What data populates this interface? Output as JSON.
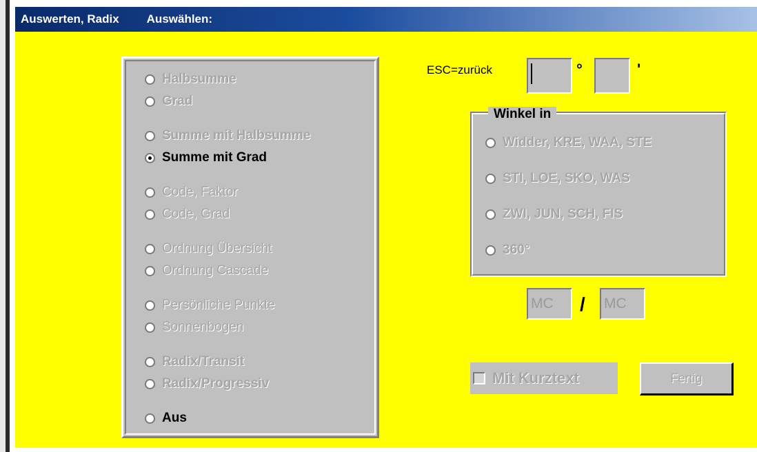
{
  "window": {
    "title": "Auswerten, Radix",
    "subtitle": "Auswählen:"
  },
  "left_options": [
    {
      "label": "Halbsumme",
      "enabled": false,
      "checked": false,
      "bold": true
    },
    {
      "label": "Grad",
      "enabled": false,
      "checked": false,
      "bold": true
    },
    {
      "label": "Summe mit Halbsumme",
      "enabled": false,
      "checked": false,
      "bold": true
    },
    {
      "label": "Summe mit Grad",
      "enabled": true,
      "checked": true,
      "bold": true
    },
    {
      "label": "Code, Faktor",
      "enabled": false,
      "checked": false,
      "bold": false
    },
    {
      "label": "Code, Grad",
      "enabled": false,
      "checked": false,
      "bold": false
    },
    {
      "label": "Ordnung Übersicht",
      "enabled": false,
      "checked": false,
      "bold": false
    },
    {
      "label": "Ordnung Cascade",
      "enabled": false,
      "checked": false,
      "bold": false
    },
    {
      "label": "Persönliche Punkte",
      "enabled": false,
      "checked": false,
      "bold": false
    },
    {
      "label": "Sonnenbogen",
      "enabled": false,
      "checked": false,
      "bold": false
    },
    {
      "label": "Radix/Transit",
      "enabled": false,
      "checked": false,
      "bold": true
    },
    {
      "label": "Radix/Progressiv",
      "enabled": false,
      "checked": false,
      "bold": true
    },
    {
      "label": "Aus",
      "enabled": true,
      "checked": false,
      "bold": true
    }
  ],
  "angle_input": {
    "label": "ESC=zurück",
    "degree_value": "",
    "degree_symbol": "°",
    "minute_value": "",
    "minute_symbol": "'"
  },
  "winkel_group": {
    "title": "Winkel in",
    "options": [
      {
        "label": "Widder, KRE, WAA, STE"
      },
      {
        "label": "STI, LOE, SKO, WAS"
      },
      {
        "label": "ZWI, JUN, SCH, FIS"
      },
      {
        "label": "360°"
      }
    ]
  },
  "mc": {
    "left": "MC",
    "separator": "/",
    "right": "MC"
  },
  "kurztext": {
    "label": "Mit Kurztext",
    "checked": false
  },
  "buttons": {
    "fertig": "Fertig"
  }
}
